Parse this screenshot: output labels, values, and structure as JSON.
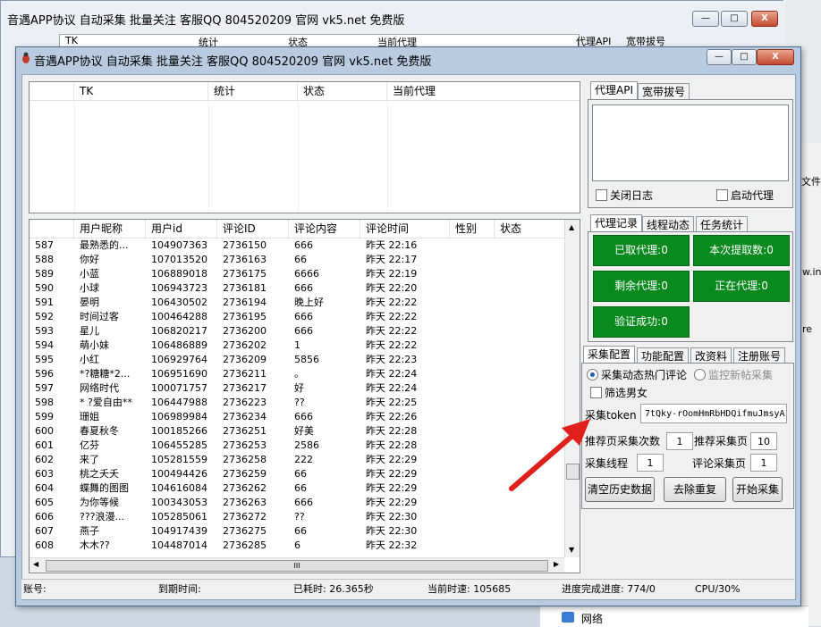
{
  "background_window": {
    "title": "音遇APP协议 自动采集 批量关注 客服QQ 804520209 官网 vk5.net 免费版",
    "headers": [
      "TK",
      "统计",
      "状态",
      "当前代理"
    ],
    "tabs": [
      "代理API",
      "宽带拔号"
    ]
  },
  "window": {
    "title": "音遇APP协议 自动采集 批量关注 客服QQ 804520209 官网 vk5.net 免费版",
    "minimize": "—",
    "maximize": "□",
    "close": "X"
  },
  "top_table": {
    "headers": [
      "TK",
      "统计",
      "状态",
      "当前代理"
    ]
  },
  "comments_table": {
    "headers": [
      "用户昵称",
      "用户id",
      "评论ID",
      "评论内容",
      "评论时间",
      "性别",
      "状态"
    ],
    "rows": [
      [
        "587",
        "最熟悉的...",
        "104907363",
        "2736150",
        "666",
        "昨天 22:16",
        "",
        ""
      ],
      [
        "588",
        "你好",
        "107013520",
        "2736163",
        "66",
        "昨天 22:17",
        "",
        ""
      ],
      [
        "589",
        "小蓝",
        "106889018",
        "2736175",
        "6666",
        "昨天 22:19",
        "",
        ""
      ],
      [
        "590",
        "小球",
        "106943723",
        "2736181",
        "666",
        "昨天 22:20",
        "",
        ""
      ],
      [
        "591",
        "晏明",
        "106430502",
        "2736194",
        "晚上好",
        "昨天 22:22",
        "",
        ""
      ],
      [
        "592",
        "时间过客",
        "100464288",
        "2736195",
        "666",
        "昨天 22:22",
        "",
        ""
      ],
      [
        "593",
        "星儿",
        "106820217",
        "2736200",
        "666",
        "昨天 22:22",
        "",
        ""
      ],
      [
        "594",
        "萌小妹",
        "106486889",
        "2736202",
        "1",
        "昨天 22:22",
        "",
        ""
      ],
      [
        "595",
        "小红",
        "106929764",
        "2736209",
        "5856",
        "昨天 22:23",
        "",
        ""
      ],
      [
        "596",
        "*?糖糖*2...",
        "106951690",
        "2736211",
        "。",
        "昨天 22:24",
        "",
        ""
      ],
      [
        "597",
        "网络时代",
        "100071757",
        "2736217",
        "好",
        "昨天 22:24",
        "",
        ""
      ],
      [
        "598",
        "* ?爱自由**",
        "106447988",
        "2736223",
        "??",
        "昨天 22:25",
        "",
        ""
      ],
      [
        "599",
        "珊姐",
        "106989984",
        "2736234",
        "666",
        "昨天 22:26",
        "",
        ""
      ],
      [
        "600",
        "春夏秋冬",
        "100185266",
        "2736251",
        "好美",
        "昨天 22:28",
        "",
        ""
      ],
      [
        "601",
        "亿芬",
        "106455285",
        "2736253",
        "2586",
        "昨天 22:28",
        "",
        ""
      ],
      [
        "602",
        "来了",
        "105281559",
        "2736258",
        "222",
        "昨天 22:29",
        "",
        ""
      ],
      [
        "603",
        "桃之夭夭",
        "100494426",
        "2736259",
        "66",
        "昨天 22:29",
        "",
        ""
      ],
      [
        "604",
        "蝶舞的图图",
        "104616084",
        "2736262",
        "66",
        "昨天 22:29",
        "",
        ""
      ],
      [
        "605",
        "为你等候",
        "100343053",
        "2736263",
        "666",
        "昨天 22:29",
        "",
        ""
      ],
      [
        "606",
        "???浪漫...",
        "105285061",
        "2736272",
        "??",
        "昨天 22:30",
        "",
        ""
      ],
      [
        "607",
        "燕子",
        "104917439",
        "2736275",
        "66",
        "昨天 22:30",
        "",
        ""
      ],
      [
        "608",
        "木木??",
        "104487014",
        "2736285",
        "6",
        "昨天 22:32",
        "",
        ""
      ]
    ],
    "scroll_marker": "III"
  },
  "proxy_panel": {
    "tabs": [
      "代理API",
      "宽带拔号"
    ],
    "close_log": "关闭日志",
    "enable_proxy": "启动代理"
  },
  "stats_panel": {
    "tabs": [
      "代理记录",
      "线程动态",
      "任务统计"
    ],
    "buttons": [
      "已取代理:0",
      "本次提取数:0",
      "剩余代理:0",
      "正在代理:0",
      "验证成功:0"
    ]
  },
  "config_panel": {
    "tabs": [
      "采集配置",
      "功能配置",
      "改资料",
      "注册账号"
    ],
    "radio_hot": "采集动态热门评论",
    "radio_monitor": "监控新帖采集",
    "filter_gender": "筛选男女",
    "token_label": "采集token",
    "token_value": "7tQky-rOomHmRbHDQifmuJmsyA",
    "rec_times_label": "推荐页采集次数",
    "rec_times_value": "1",
    "rec_page_label": "推荐采集页",
    "rec_page_value": "10",
    "threads_label": "采集线程",
    "threads_value": "1",
    "comment_page_label": "评论采集页",
    "comment_page_value": "1",
    "btn_clear": "清空历史数据",
    "btn_dedupe": "去除重复",
    "btn_start": "开始采集"
  },
  "status_bar": {
    "account": "账号:",
    "expire": "到期时间:",
    "elapsed": "已耗时: 26.365秒",
    "speed": "当前时速: 105685",
    "progress": "进度完成进度: 774/0",
    "cpu": "CPU/30%"
  },
  "side": {
    "text1": "文件",
    "text2": "w.ini",
    "text3": "re",
    "network": "网络"
  },
  "colors": {
    "accent_green": "#0a8a1e",
    "arrow_red": "#e0201c"
  }
}
